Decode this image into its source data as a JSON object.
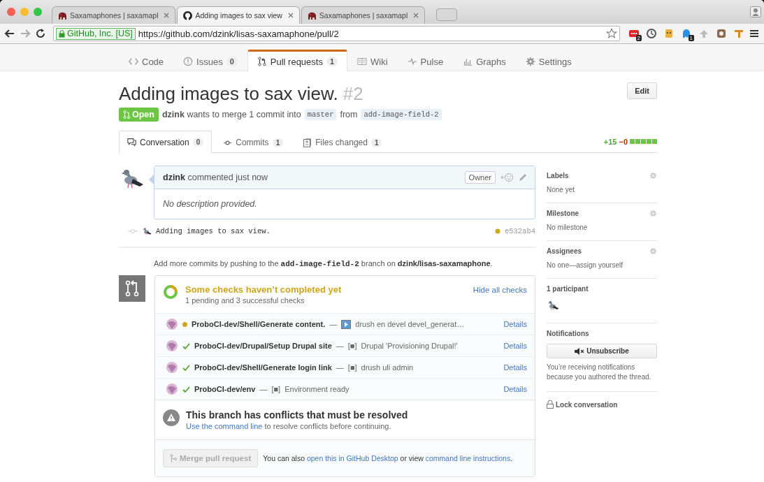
{
  "browser": {
    "tabs": [
      {
        "kind": "site",
        "title": "Saxamaphones | saxamapl",
        "selected": false
      },
      {
        "kind": "github",
        "title": "Adding images to sax view",
        "selected": true
      },
      {
        "kind": "site",
        "title": "Saxamaphones | saxamapl",
        "selected": false
      }
    ],
    "identity": "GitHub, Inc. [US]",
    "url": "https://github.com/dzink/lisas-saxamaphone/pull/2",
    "extensions": [
      {
        "kind": "red",
        "badge": "2"
      },
      {
        "kind": "clock"
      },
      {
        "kind": "face"
      },
      {
        "kind": "ghost",
        "badge": "1"
      },
      {
        "kind": "arrow"
      },
      {
        "kind": "camera"
      },
      {
        "kind": "tool"
      }
    ]
  },
  "repo_nav": [
    {
      "kind": "code",
      "label": "Code",
      "selected": false
    },
    {
      "kind": "issues",
      "label": "Issues",
      "count": "0",
      "selected": false
    },
    {
      "kind": "pulls",
      "label": "Pull requests",
      "count": "1",
      "selected": true
    },
    {
      "kind": "wiki",
      "label": "Wiki",
      "selected": false
    },
    {
      "kind": "pulse",
      "label": "Pulse",
      "selected": false
    },
    {
      "kind": "graphs",
      "label": "Graphs",
      "selected": false
    },
    {
      "kind": "settings",
      "label": "Settings",
      "selected": false
    }
  ],
  "pull_request": {
    "title": "Adding images to sax view.",
    "number": "#2",
    "edit_button": "Edit",
    "state": "Open",
    "author": "dzink",
    "merge_text": "wants to merge 1 commit into",
    "base": "master",
    "from_text": "from",
    "head": "add-image-field-2"
  },
  "pr_tabs": [
    {
      "kind": "conversation",
      "label": "Conversation",
      "count": "0",
      "selected": true
    },
    {
      "kind": "commits",
      "label": "Commits",
      "count": "1",
      "selected": false
    },
    {
      "kind": "files",
      "label": "Files changed",
      "count": "1",
      "selected": false
    }
  ],
  "diffstat": {
    "additions": "+15",
    "deletions": "−0"
  },
  "comment": {
    "author": "dzink",
    "action": "commented just now",
    "role": "Owner",
    "body": "No description provided."
  },
  "commit": {
    "message": "Adding images to sax view.",
    "pending": true,
    "sha": "e532ab4"
  },
  "push_hint": {
    "before": "Add more commits by pushing to the",
    "branch": "add-image-field-2",
    "middle": "branch on",
    "repo": "dzink/lisas-saxamaphone",
    "after": "."
  },
  "checks": {
    "title": "Some checks haven’t completed yet",
    "summary": "1 pending and 3 successful checks",
    "toggle": "Hide all checks",
    "items": [
      {
        "kind": "pending",
        "name": "ProboCI-dev/Shell/Generate content.",
        "separator": "—",
        "image_icon": true,
        "description": "drush en devel devel_generat…",
        "link": "Details"
      },
      {
        "kind": "success",
        "name": "ProboCI-dev/Drupal/Setup Drupal site",
        "separator": "—",
        "glyph": "[■]",
        "description": "Drupal 'Provisioning Drupal!'",
        "link": "Details"
      },
      {
        "kind": "success",
        "name": "ProboCI-dev/Shell/Generate login link",
        "separator": "—",
        "glyph": "[■]",
        "description": "drush uli admin",
        "link": "Details"
      },
      {
        "kind": "success",
        "name": "ProboCI-dev/env",
        "separator": "—",
        "glyph": "[■]",
        "description": "Environment ready",
        "link": "Details"
      }
    ]
  },
  "conflict": {
    "title": "This branch has conflicts that must be resolved",
    "link": "Use the command line",
    "text": "to resolve conflicts before continuing."
  },
  "merge": {
    "button": "Merge pull request",
    "disabled": true,
    "before": "You can also",
    "link1": "open this in GitHub Desktop",
    "middle": "or view",
    "link2": "command line instructions",
    "after": "."
  },
  "sidebar": {
    "sections": [
      {
        "heading": "Labels",
        "value": "None yet"
      },
      {
        "heading": "Milestone",
        "value": "No milestone"
      },
      {
        "heading": "Assignees",
        "value": "No one—assign yourself"
      }
    ],
    "participants": "1 participant",
    "notifications": {
      "heading": "Notifications",
      "button": "Unsubscribe",
      "note": "You’re receiving notifications because you authored the thread."
    },
    "lock": "Lock conversation"
  }
}
